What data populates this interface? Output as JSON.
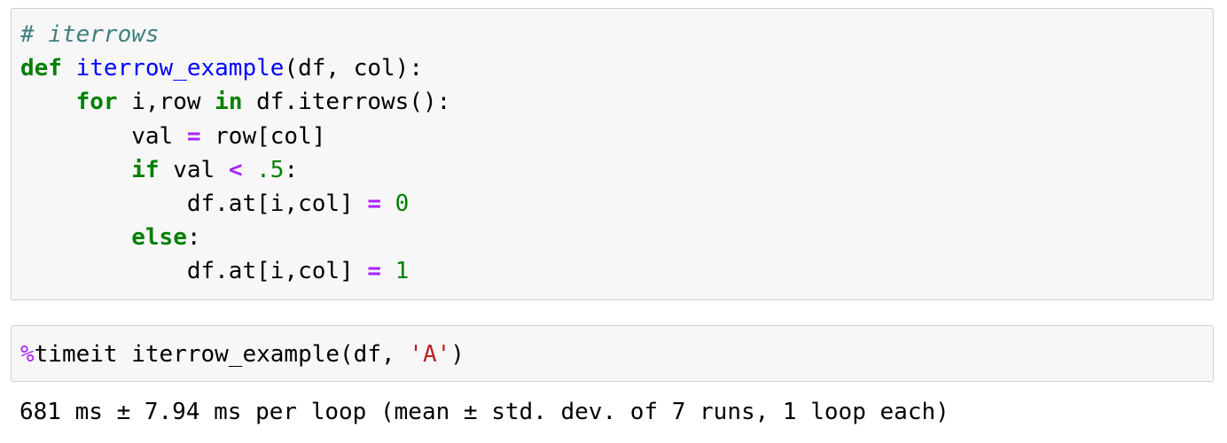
{
  "cells": [
    {
      "lines": [
        [
          {
            "t": "# iterrows",
            "c": "cm"
          }
        ],
        [
          {
            "t": "def",
            "c": "kw"
          },
          {
            "t": " "
          },
          {
            "t": "iterrow_example",
            "c": "fn"
          },
          {
            "t": "(df, col):"
          }
        ],
        [
          {
            "t": "    "
          },
          {
            "t": "for",
            "c": "kw"
          },
          {
            "t": " i,row "
          },
          {
            "t": "in",
            "c": "kw"
          },
          {
            "t": " df.iterrows():"
          }
        ],
        [
          {
            "t": "        val "
          },
          {
            "t": "=",
            "c": "op"
          },
          {
            "t": " row[col]"
          }
        ],
        [
          {
            "t": "        "
          },
          {
            "t": "if",
            "c": "kw"
          },
          {
            "t": " val "
          },
          {
            "t": "<",
            "c": "op"
          },
          {
            "t": " "
          },
          {
            "t": ".5",
            "c": "num"
          },
          {
            "t": ":"
          }
        ],
        [
          {
            "t": "            df.at[i,col] "
          },
          {
            "t": "=",
            "c": "op"
          },
          {
            "t": " "
          },
          {
            "t": "0",
            "c": "num"
          }
        ],
        [
          {
            "t": "        "
          },
          {
            "t": "else",
            "c": "kw"
          },
          {
            "t": ":"
          }
        ],
        [
          {
            "t": "            df.at[i,col] "
          },
          {
            "t": "=",
            "c": "op"
          },
          {
            "t": " "
          },
          {
            "t": "1",
            "c": "num"
          }
        ]
      ]
    },
    {
      "lines": [
        [
          {
            "t": "%",
            "c": "mg"
          },
          {
            "t": "timeit iterrow_example(df, "
          },
          {
            "t": "'A'",
            "c": "str"
          },
          {
            "t": ")"
          }
        ]
      ]
    }
  ],
  "output": {
    "text": "681 ms ± 7.94 ms per loop (mean ± std. dev. of 7 runs, 1 loop each)"
  },
  "colors": {
    "keyword": "#008000",
    "function": "#0000ff",
    "operator": "#aa22ff",
    "number": "#008000",
    "string": "#ba2121",
    "comment": "#408080",
    "cell_background": "#f7f7f7",
    "cell_border": "#cfcfcf"
  }
}
